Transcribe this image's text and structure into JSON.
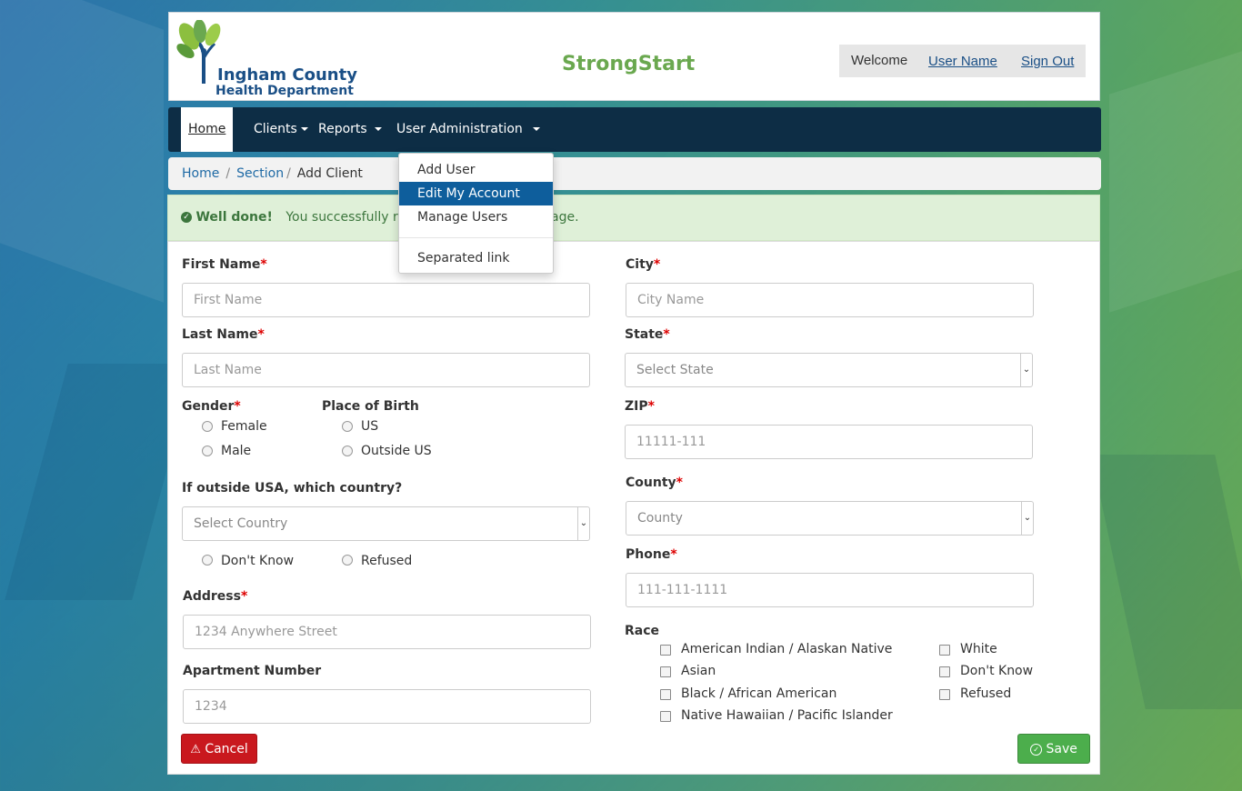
{
  "header": {
    "logo_line1": "Ingham County",
    "logo_line2": "Health Department",
    "app_title": "StrongStart",
    "welcome": "Welcome",
    "user_name": "User Name",
    "sign_out": "Sign Out"
  },
  "nav": {
    "home": "Home",
    "clients": "Clients",
    "reports": "Reports",
    "user_admin": "User Administration"
  },
  "dropdown": {
    "items": [
      "Add User",
      "Edit My Account",
      "Manage Users"
    ],
    "separated": "Separated link",
    "highlighted": "Edit My Account"
  },
  "breadcrumb": {
    "home": "Home",
    "section": "Section",
    "current": "Add Client",
    "separator": "/"
  },
  "alert": {
    "strong": "Well done!",
    "message_start": "You successfully read",
    "message_end": "age."
  },
  "form": {
    "first_name": {
      "label": "First Name",
      "placeholder": "First Name"
    },
    "last_name": {
      "label": "Last Name",
      "placeholder": "Last Name"
    },
    "gender": {
      "label": "Gender",
      "options": [
        "Female",
        "Male"
      ]
    },
    "place_of_birth": {
      "label": "Place of Birth",
      "options": [
        "US",
        "Outside US"
      ]
    },
    "country": {
      "label": "If outside USA, which country?",
      "placeholder": "Select Country",
      "options": [
        "Don't Know",
        "Refused"
      ]
    },
    "address": {
      "label": "Address",
      "placeholder": "1234 Anywhere Street"
    },
    "apartment": {
      "label": "Apartment Number",
      "placeholder": "1234"
    },
    "city": {
      "label": "City",
      "placeholder": "City Name"
    },
    "state": {
      "label": "State",
      "placeholder": "Select State"
    },
    "zip": {
      "label": "ZIP",
      "placeholder": "11111-111"
    },
    "county": {
      "label": "County",
      "placeholder": "County"
    },
    "phone": {
      "label": "Phone",
      "placeholder": "111-111-1111"
    },
    "race": {
      "label": "Race",
      "col1": [
        "American Indian / Alaskan Native",
        "Asian",
        "Black / African American",
        "Native Hawaiian / Pacific Islander"
      ],
      "col2": [
        "White",
        "Don't Know",
        "Refused"
      ]
    },
    "required_mark": "*",
    "cancel": "Cancel",
    "save": "Save"
  },
  "colors": {
    "navbar": "#0d2d45",
    "brand_green": "#6aa84f",
    "cancel": "#c9181e",
    "save": "#4cae4c",
    "highlight": "#0e5e9c"
  }
}
